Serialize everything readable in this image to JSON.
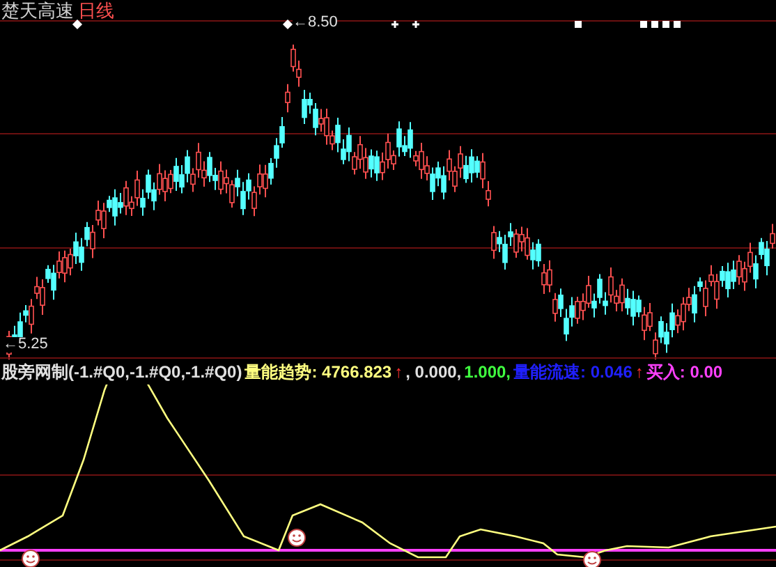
{
  "header": {
    "stock_name": "楚天高速",
    "period": "日线"
  },
  "price_panel": {
    "high_label": "←8.50",
    "low_label": "←5.25"
  },
  "indicator_legend": [
    {
      "text": "股旁网制(-1.#Q0,-1.#Q0,-1.#Q0)",
      "color": "#e0e0e0"
    },
    {
      "text": "量能趋势: 4766.823",
      "color": "#ffff80"
    },
    {
      "text": "↑",
      "color": "#ff3030"
    },
    {
      "text": ", 0.000,",
      "color": "#e0e0e0"
    },
    {
      "text": "1.000,",
      "color": "#40ff40"
    },
    {
      "text": "量能流速: 0.046",
      "color": "#2020ff"
    },
    {
      "text": "↑",
      "color": "#ff3030"
    },
    {
      "text": "买入: 0.00",
      "color": "#ff40ff"
    }
  ]
}
